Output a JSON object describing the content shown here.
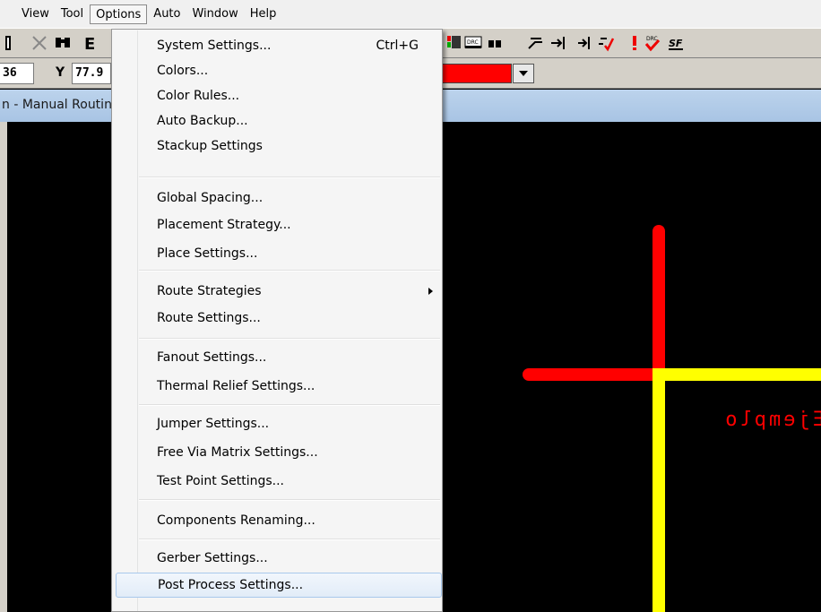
{
  "menubar": {
    "items": [
      "View",
      "Tool",
      "Options",
      "Auto",
      "Window",
      "Help"
    ],
    "active_index": 2
  },
  "coords": {
    "x_value": "36",
    "y_label": "Y",
    "y_value": "77.9"
  },
  "document": {
    "title": "n - Manual Routing"
  },
  "layer_color": "#ff0000",
  "menu": {
    "items": [
      {
        "label": "System Settings...",
        "shortcut": "Ctrl+G"
      },
      {
        "label": "Colors..."
      },
      {
        "label": "Color Rules..."
      },
      {
        "label": "Auto Backup..."
      },
      {
        "label": "Stackup Settings"
      },
      {
        "label": "Global Spacing..."
      },
      {
        "label": "Placement Strategy..."
      },
      {
        "label": "Place Settings..."
      },
      {
        "label": "Route Strategies",
        "submenu": true
      },
      {
        "label": "Route Settings..."
      },
      {
        "label": "Fanout Settings..."
      },
      {
        "label": "Thermal Relief Settings..."
      },
      {
        "label": "Jumper Settings..."
      },
      {
        "label": "Free Via Matrix Settings..."
      },
      {
        "label": "Test Point Settings..."
      },
      {
        "label": "Components Renaming..."
      },
      {
        "label": "Gerber Settings..."
      },
      {
        "label": "Post Process Settings..."
      }
    ],
    "hover_index": 17
  },
  "canvas": {
    "mirrored_text": "Ejemplo",
    "trace_colors": {
      "red": "#ff0000",
      "yellow": "#ffff00"
    }
  }
}
